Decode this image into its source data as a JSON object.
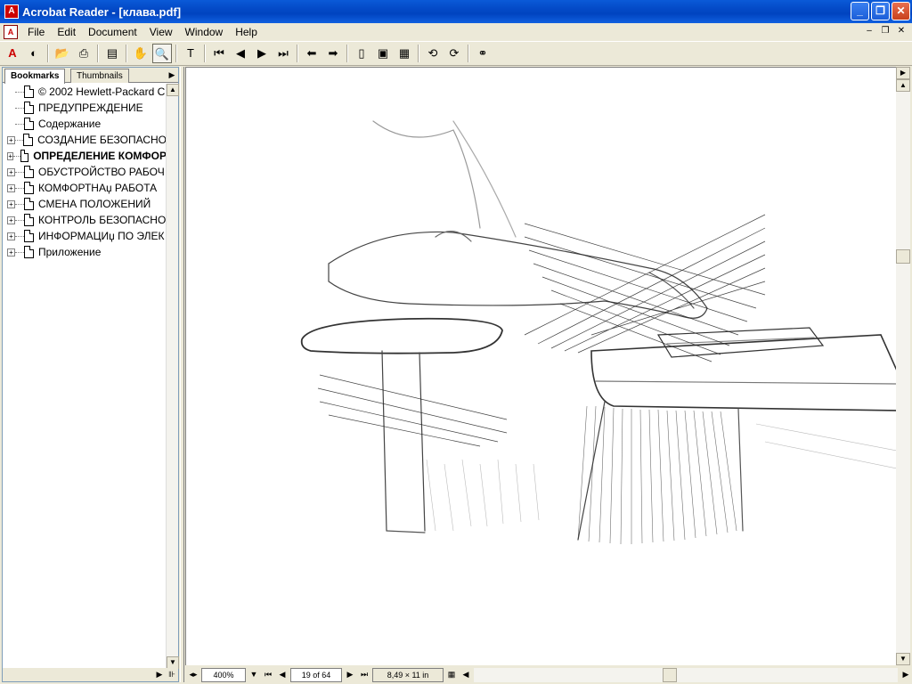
{
  "window": {
    "title": "Acrobat Reader - [клава.pdf]",
    "minimize": "_",
    "restore": "❐",
    "close": "✕"
  },
  "menu": {
    "items": [
      "File",
      "Edit",
      "Document",
      "View",
      "Window",
      "Help"
    ],
    "mdi": [
      "–",
      "❐",
      "✕"
    ]
  },
  "toolbar": {
    "buttons": [
      {
        "name": "acrobat-logo-icon",
        "glyph": "A"
      },
      {
        "name": "acrobat-online-icon",
        "glyph": "◐"
      },
      {
        "sep": true
      },
      {
        "name": "open-folder-icon",
        "glyph": "📂"
      },
      {
        "name": "print-icon",
        "glyph": "⎙"
      },
      {
        "sep": true
      },
      {
        "name": "show-navigation-pane-icon",
        "glyph": "▤"
      },
      {
        "sep": true
      },
      {
        "name": "hand-tool-icon",
        "glyph": "✋"
      },
      {
        "name": "zoom-tool-icon",
        "glyph": "🔍",
        "pressed": true
      },
      {
        "sep": true
      },
      {
        "name": "text-select-tool-icon",
        "glyph": "T"
      },
      {
        "sep": true
      },
      {
        "name": "first-page-icon",
        "glyph": "⏮"
      },
      {
        "name": "previous-page-icon",
        "glyph": "◀"
      },
      {
        "name": "next-page-icon",
        "glyph": "▶"
      },
      {
        "name": "last-page-icon",
        "glyph": "⏭"
      },
      {
        "sep": true
      },
      {
        "name": "go-back-icon",
        "glyph": "⬅"
      },
      {
        "name": "go-forward-icon",
        "glyph": "➡"
      },
      {
        "sep": true
      },
      {
        "name": "actual-size-icon",
        "glyph": "▯"
      },
      {
        "name": "fit-page-icon",
        "glyph": "▣"
      },
      {
        "name": "fit-width-icon",
        "glyph": "▦"
      },
      {
        "sep": true
      },
      {
        "name": "rotate-left-icon",
        "glyph": "⟲"
      },
      {
        "name": "rotate-right-icon",
        "glyph": "⟳"
      },
      {
        "sep": true
      },
      {
        "name": "find-binoculars-icon",
        "glyph": "⚭"
      }
    ]
  },
  "panel": {
    "tabs": [
      "Bookmarks",
      "Thumbnails"
    ],
    "bookmarks": [
      {
        "label": "© 2002 Hewlett-Packard C",
        "expandable": false,
        "bold": false
      },
      {
        "label": "ПРЕДУПРЕЖДЕНИЕ",
        "expandable": false,
        "bold": false
      },
      {
        "label": "Содержание",
        "expandable": false,
        "bold": false
      },
      {
        "label": "СОЗДАНИЕ БЕЗОПАСНО",
        "expandable": true,
        "bold": false
      },
      {
        "label": "ОПРЕДЕЛЕНИЕ КОМФОР",
        "expandable": true,
        "bold": true
      },
      {
        "label": "ОБУСТРОЙСТВО РАБОЧ",
        "expandable": true,
        "bold": false
      },
      {
        "label": "КОМФОРТНАџ РАБОТА",
        "expandable": true,
        "bold": false
      },
      {
        "label": "СМЕНА ПОЛОЖЕНИЙ",
        "expandable": true,
        "bold": false
      },
      {
        "label": "КОНТРОЛЬ БЕЗОПАСНО",
        "expandable": true,
        "bold": false
      },
      {
        "label": "ИНФОРМАЦИџ ПО ЭЛЕК",
        "expandable": true,
        "bold": false
      },
      {
        "label": "Приложение",
        "expandable": true,
        "bold": false
      }
    ]
  },
  "status": {
    "zoom": "400%",
    "page": "19 of 64",
    "page_size": "8,49 × 11 in"
  },
  "colors": {
    "titlebar": "#0349c6",
    "chrome": "#ece9d8"
  }
}
